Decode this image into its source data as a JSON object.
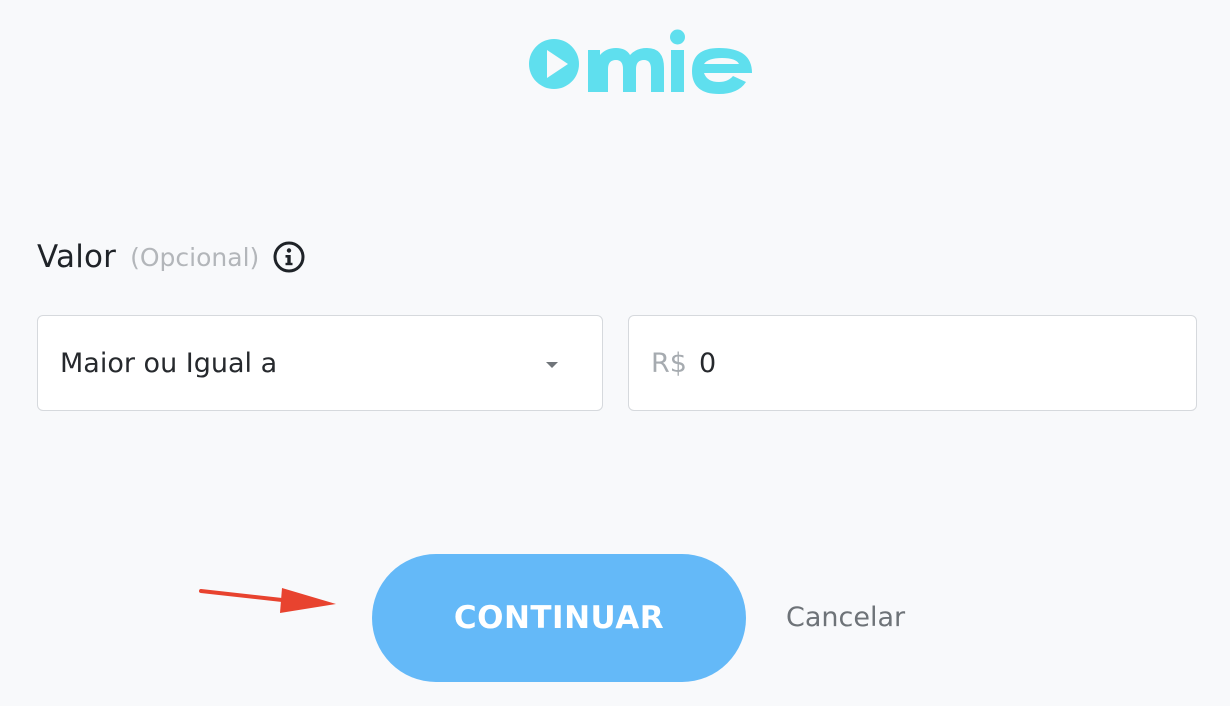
{
  "brand": {
    "logo_text": "omie",
    "color": "#5fdfee"
  },
  "filter": {
    "label": "Valor",
    "optional_label": "(Opcional)",
    "info_icon": "info-icon",
    "operator": {
      "selected": "Maior ou Igual a",
      "icon": "chevron-down-icon"
    },
    "amount": {
      "prefix": "R$",
      "value": "0"
    }
  },
  "actions": {
    "continue_label": "CONTINUAR",
    "cancel_label": "Cancelar",
    "primary_color": "#64b9f8"
  },
  "annotation": {
    "arrow_color": "#e8432f"
  }
}
